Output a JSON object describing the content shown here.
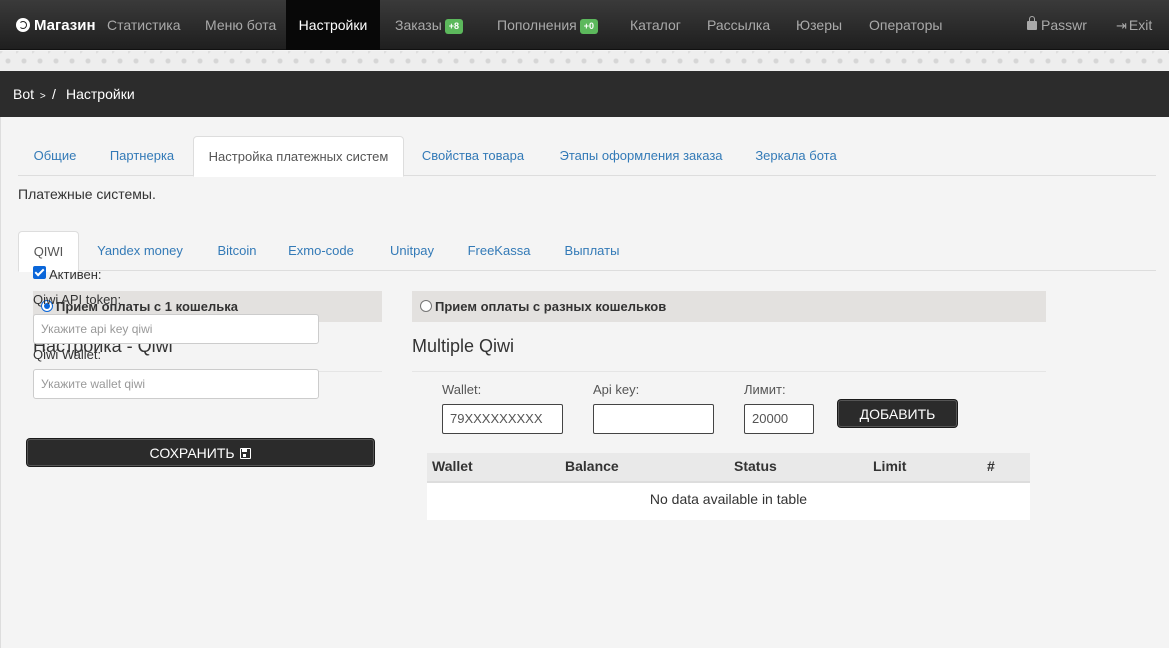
{
  "navbar": {
    "brand": "Магазин",
    "items": [
      {
        "label": "Статистика"
      },
      {
        "label": "Меню бота"
      },
      {
        "label": "Настройки"
      },
      {
        "label": "Заказы",
        "badge": "+8"
      },
      {
        "label": "Пополнения",
        "badge": "+0"
      },
      {
        "label": "Каталог"
      },
      {
        "label": "Рассылка"
      },
      {
        "label": "Юзеры"
      },
      {
        "label": "Операторы"
      }
    ],
    "passwr": "Passwr",
    "exit": "Exit"
  },
  "breadcrumb": {
    "root": "Bot",
    "arrow": ">",
    "separator": "/",
    "current": "Настройки"
  },
  "settings_tabs": [
    "Общие",
    "Партнерка",
    "Настройка платежных систем",
    "Свойства товара",
    "Этапы оформления заказа",
    "Зеркала бота"
  ],
  "section_title": "Платежные системы.",
  "payment_tabs": [
    "QIWI",
    "Yandex money",
    "Bitcoin",
    "Exmo-code",
    "Unitpay",
    "FreeKassa",
    "Выплаты"
  ],
  "single": {
    "radio_label": "Прием оплаты с 1 кошелька",
    "heading": "Настройка - Qiwi",
    "active_label": "Активен:",
    "token_label": "Qiwi API token:",
    "token_placeholder": "Укажите api key qiwi",
    "wallet_label": "Qiwi Wallet:",
    "wallet_placeholder": "Укажите wallet qiwi",
    "save_label": "СОХРАНИТЬ"
  },
  "multiple": {
    "radio_label": "Прием оплаты с разных кошельков",
    "heading": "Multiple Qiwi",
    "wallet_label": "Wallet:",
    "wallet_value": "79XXXXXXXXX",
    "apikey_label": "Api key:",
    "apikey_value": "",
    "limit_label": "Лимит:",
    "limit_value": "20000",
    "add_label": "ДОБАВИТЬ",
    "columns": [
      "Wallet",
      "Balance",
      "Status",
      "Limit",
      "#"
    ],
    "empty_text": "No data available in table"
  }
}
